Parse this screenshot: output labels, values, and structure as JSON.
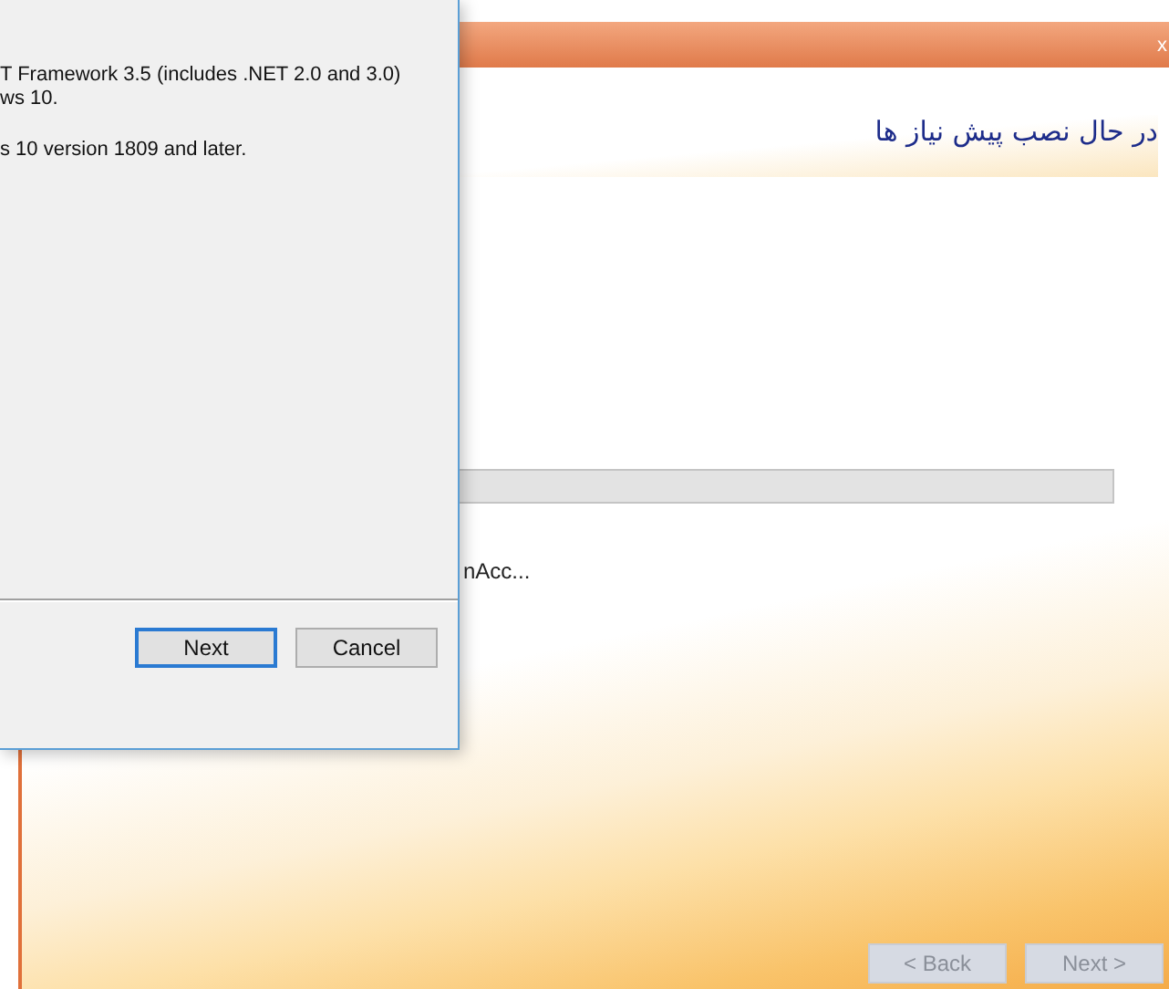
{
  "installer": {
    "close": "x",
    "heading": "در حال نصب پیش نیاز ها",
    "progress": {
      "level": 0
    },
    "status": "nAcc...",
    "buttons": [
      {
        "label": "< Back",
        "disabled": true
      },
      {
        "label": "Next >",
        "disabled": true
      }
    ]
  },
  "dialog": {
    "lines": [
      "T Framework 3.5 (includes .NET 2.0 and 3.0)",
      "ws 10.",
      "s 10 version 1809 and later."
    ],
    "buttons": [
      {
        "label": "Next",
        "default": true
      },
      {
        "label": "Cancel",
        "default": false
      }
    ]
  }
}
